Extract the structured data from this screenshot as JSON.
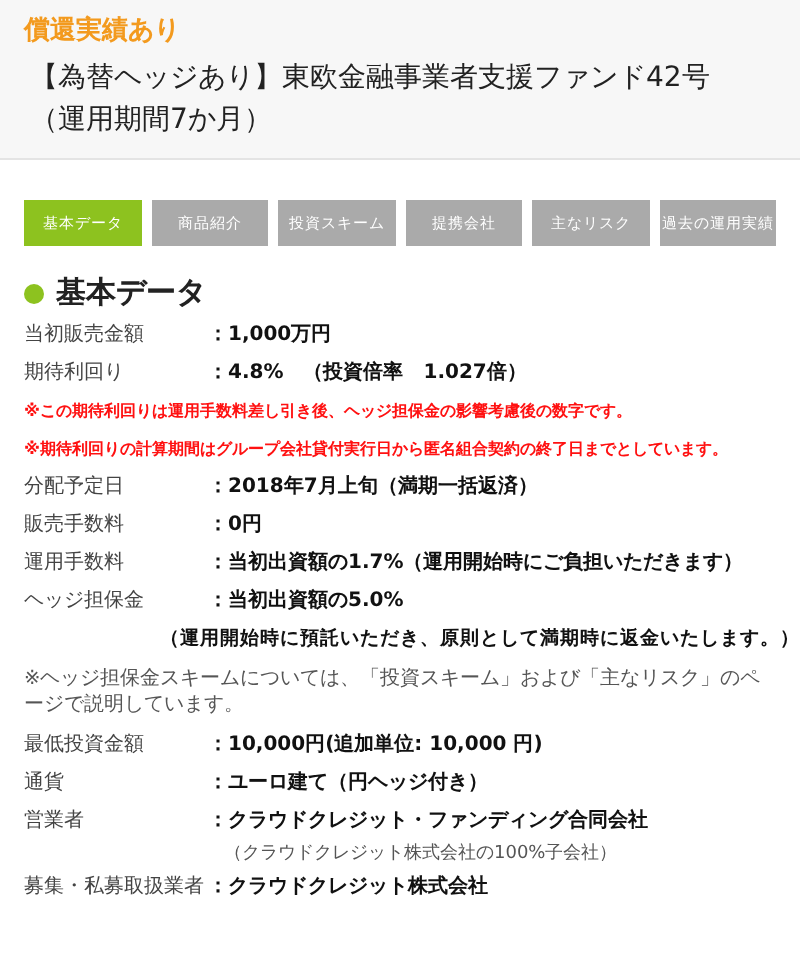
{
  "header": {
    "badge": "償還実績あり",
    "title_lines": [
      "【為替ヘッジあり】東欧金融事業者支援ファンド42号",
      "（運用期間7か月）"
    ]
  },
  "tabs": [
    {
      "label": "基本データ",
      "selected": true
    },
    {
      "label": "商品紹介",
      "selected": false
    },
    {
      "label": "投資スキーム",
      "selected": false
    },
    {
      "label": "提携会社",
      "selected": false
    },
    {
      "label": "主なリスク",
      "selected": false
    },
    {
      "label": "過去の運用実績",
      "selected": false
    }
  ],
  "section": {
    "heading": "基本データ",
    "items": [
      {
        "kind": "row",
        "label": "当初販売金額",
        "value": "：1,000万円"
      },
      {
        "kind": "row",
        "label": "期待利回り",
        "value": "：4.8%　（投資倍率　1.027倍）"
      },
      {
        "kind": "note",
        "text": "※この期待利回りは運用手数料差し引き後、ヘッジ担保金の影響考慮後の数字です。"
      },
      {
        "kind": "note",
        "text": "※期待利回りの計算期間はグループ会社貸付実行日から匿名組合契約の終了日までとしています。"
      },
      {
        "kind": "row",
        "label": "分配予定日",
        "value": "：2018年7月上旬（満期一括返済）"
      },
      {
        "kind": "row",
        "label": "販売手数料",
        "value": "：0円"
      },
      {
        "kind": "row",
        "label": "運用手数料",
        "value": "：当初出資額の1.7%（運用開始時にご負担いただきます）"
      },
      {
        "kind": "row",
        "label": "ヘッジ担保金",
        "value": "：当初出資額の5.0%"
      },
      {
        "kind": "indent",
        "text": "（運用開始時に預託いただき、原則として満期時に返金いたします。）"
      },
      {
        "kind": "para",
        "text": "※ヘッジ担保金スキームについては、「投資スキーム」および「主なリスク」のページで説明しています。"
      },
      {
        "kind": "row",
        "label": "最低投資金額",
        "value": "：10,000円(追加単位: 10,000 円)"
      },
      {
        "kind": "row",
        "label": "通貨",
        "value": "：ユーロ建て（円ヘッジ付き）"
      },
      {
        "kind": "row",
        "label": "営業者",
        "value": "：クラウドクレジット・ファンディング合同会社"
      },
      {
        "kind": "sub",
        "text": "（クラウドクレジット株式会社の100%子会社）"
      },
      {
        "kind": "row",
        "label": "募集・私募取扱業者",
        "value": "：クラウドクレジット株式会社"
      }
    ]
  }
}
